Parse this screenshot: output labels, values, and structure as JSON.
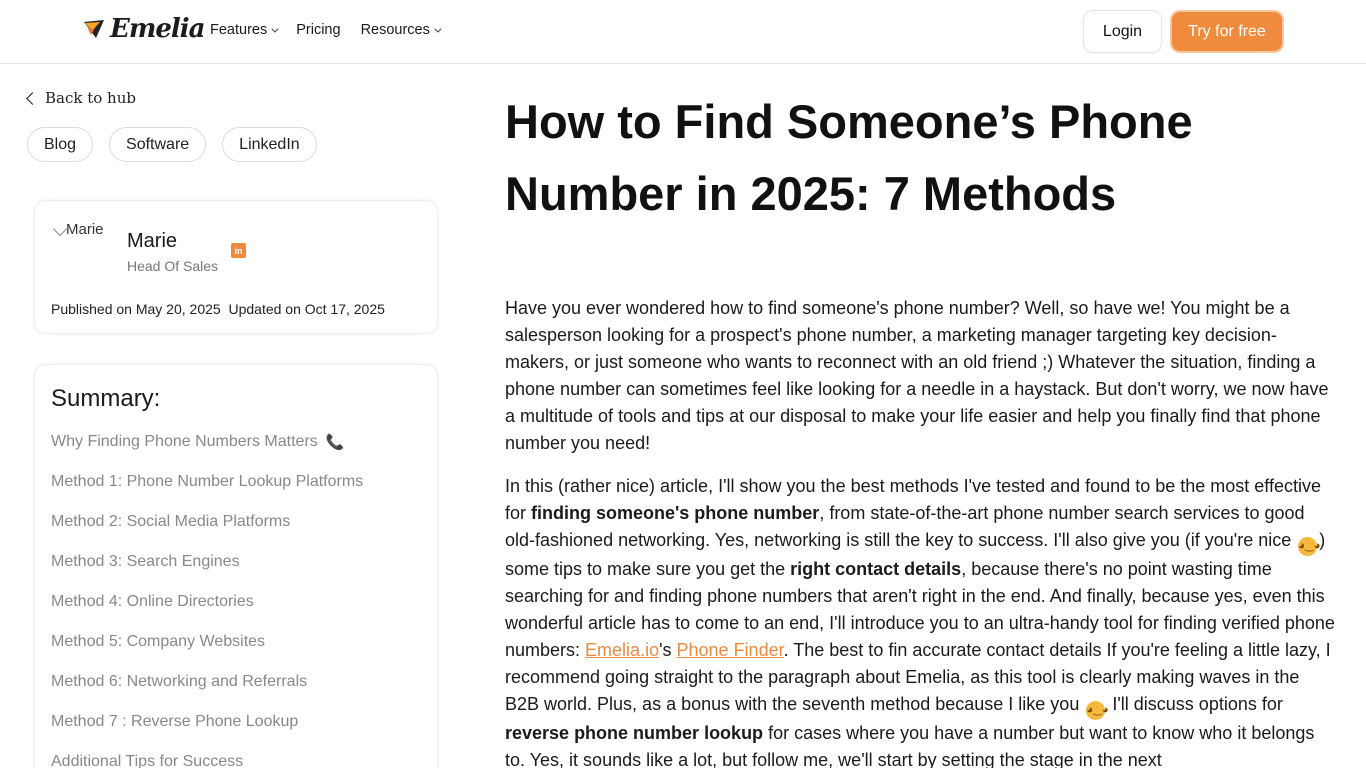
{
  "header": {
    "logo_text": "Emelia",
    "nav": [
      {
        "label": "Features",
        "has_dropdown": true
      },
      {
        "label": "Pricing",
        "has_dropdown": false
      },
      {
        "label": "Resources",
        "has_dropdown": true
      }
    ],
    "login_label": "Login",
    "try_label": "Try for free"
  },
  "sidebar": {
    "back_label": "Back to hub",
    "tags": [
      "Blog",
      "Software",
      "LinkedIn"
    ],
    "author": {
      "avatar_alt": "Marie",
      "name": "Marie",
      "role": "Head Of Sales",
      "published": "Published on May 20, 2025",
      "updated": "Updated on Oct 17, 2025"
    },
    "summary": {
      "title": "Summary:",
      "items": [
        "Why Finding Phone Numbers Matters",
        "Method 1: Phone Number Lookup Platforms",
        "Method 2: Social Media Platforms",
        "Method 3: Search Engines",
        "Method 4: Online Directories",
        "Method 5: Company Websites",
        "Method 6: Networking and Referrals",
        "Method 7 : Reverse Phone Lookup",
        "Additional Tips for Success"
      ]
    }
  },
  "article": {
    "title": "How to Find Someone’s Phone Number in 2025: 7 Methods",
    "p1": "Have you ever wondered how to find someone's phone number? Well, so have we! You might be a salesperson looking for a prospect's phone number, a marketing manager targeting key decision-makers, or just someone who wants to reconnect with an old friend ;) Whatever the situation, finding a phone number can sometimes feel like looking for a needle in a haystack. But don't worry, we now have a multitude of tools and tips at our disposal to make your life easier and help you finally find that phone number you need!",
    "p2": {
      "t1": "In this (rather nice) article, I'll show you the best methods I've tested and found to be the most effective for ",
      "b1": "finding someone's phone number",
      "t2": ", from state-of-the-art phone number search services to good old-fashioned networking. Yes, networking is still the key to success. I'll also give you (if you're nice ",
      "t3": ") some tips to make sure you get the ",
      "b2": "right contact details",
      "t4": ", because there's no point wasting time searching for and finding phone numbers that aren't right in the end. And finally, because yes, even this wonderful article has to come to an end, I'll introduce you to an ultra-handy tool for finding verified phone numbers: ",
      "link1": "Emelia.io",
      "t5": "'s ",
      "link2": "Phone Finder",
      "t6": ". The best to fin accurate contact details If you're feeling a little lazy, I recommend going straight to the paragraph about Emelia, as this tool is clearly making waves in the B2B world. Plus, as a bonus with the seventh method because I like you ",
      "t7": " I'll discuss options for ",
      "b3": "reverse phone number lookup",
      "t8": " for cases where you have a number but want to know who it belongs to. Yes, it sounds like a lot, but follow me, we'll start by setting the stage in the next"
    }
  },
  "colors": {
    "accent": "#ef8a3f",
    "text": "#111111",
    "muted": "#888888"
  }
}
